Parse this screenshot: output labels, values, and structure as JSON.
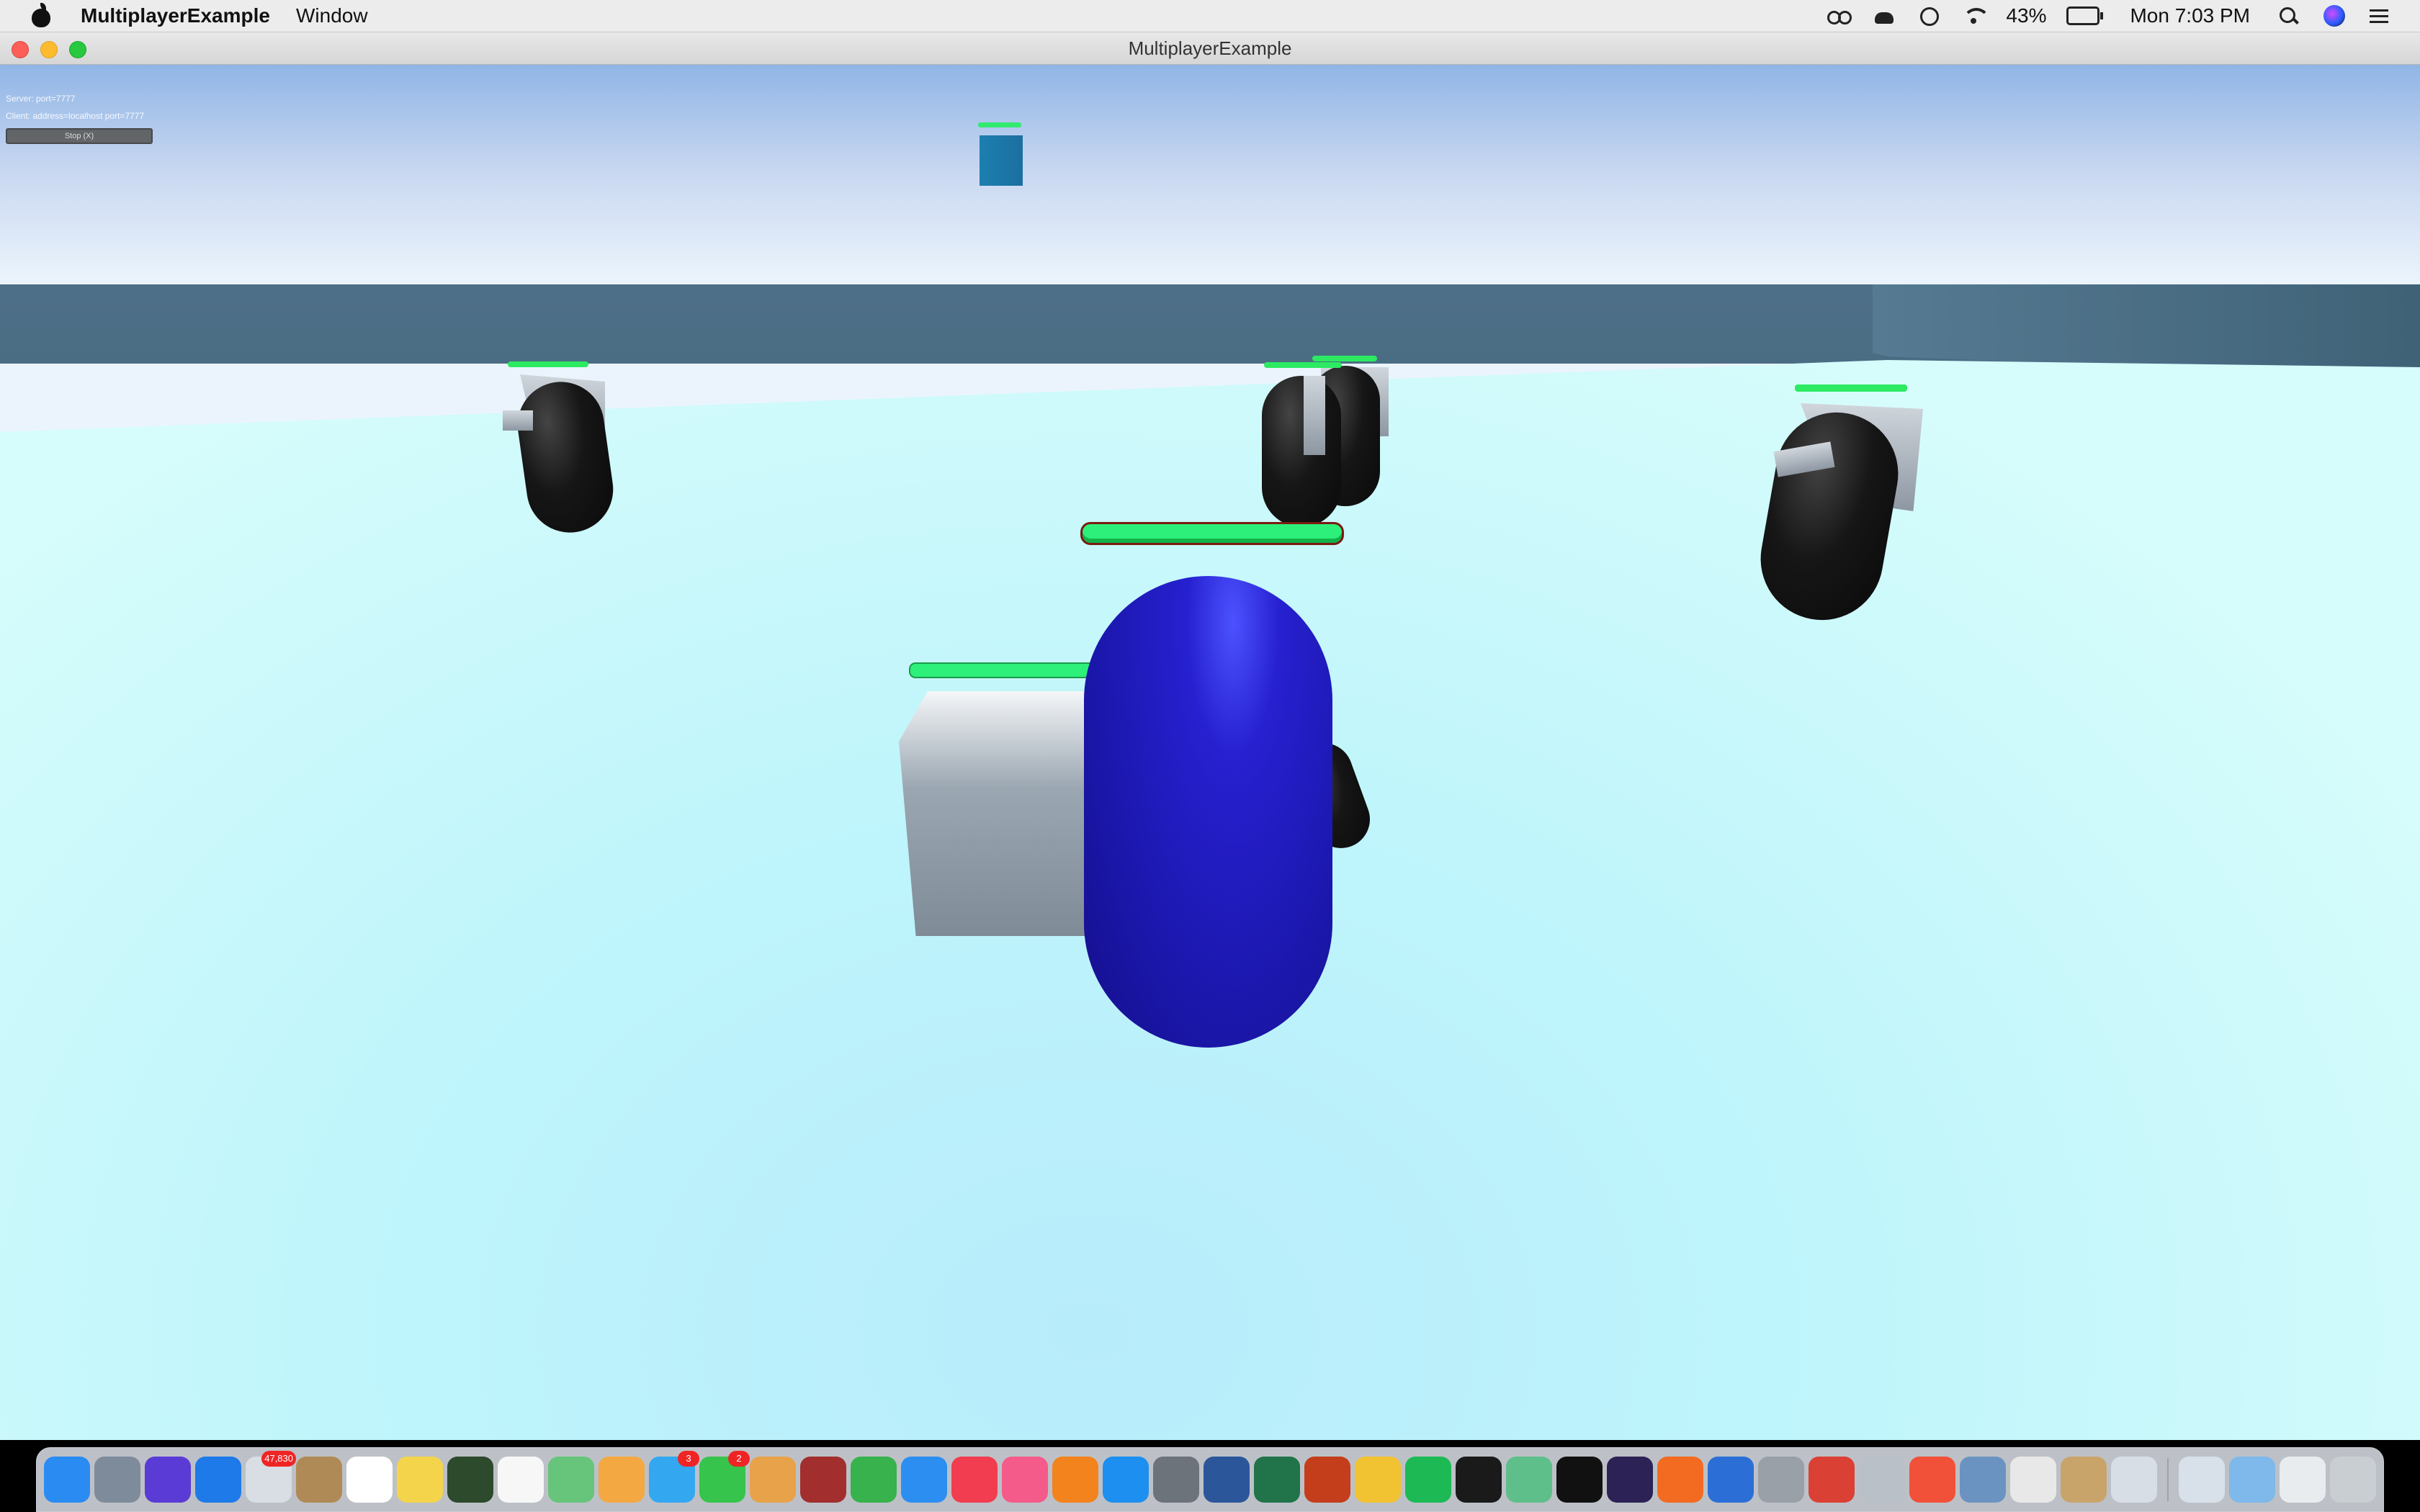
{
  "menubar": {
    "app_name": "MultiplayerExample",
    "items": [
      "Window"
    ],
    "battery_percent": "43%",
    "clock": "Mon 7:03 PM"
  },
  "window": {
    "title": "MultiplayerExample"
  },
  "hud": {
    "server": "Server: port=7777",
    "client": "Client: address=localhost port=7777",
    "stop_label": "Stop (X)"
  },
  "dock": {
    "apps": [
      {
        "name": "finder-icon",
        "color": "#2a8cf2"
      },
      {
        "name": "launchpad-icon",
        "color": "#7e8b9b"
      },
      {
        "name": "siri-icon",
        "color": "#5b3bd6"
      },
      {
        "name": "safari-icon",
        "color": "#1d7ae8"
      },
      {
        "name": "mail-icon",
        "color": "#d9dee4",
        "badge": "47,830"
      },
      {
        "name": "contacts-icon",
        "color": "#b08a56"
      },
      {
        "name": "calendar-icon",
        "color": "#ffffff"
      },
      {
        "name": "notes-icon",
        "color": "#f4d44b"
      },
      {
        "name": "mission-control-icon",
        "color": "#2d4a2c"
      },
      {
        "name": "reminders-icon",
        "color": "#f7f7f7"
      },
      {
        "name": "maps-icon",
        "color": "#66c57a"
      },
      {
        "name": "photos-icon",
        "color": "#f3a842"
      },
      {
        "name": "messages-icon",
        "color": "#34a7f1",
        "badge": "3"
      },
      {
        "name": "facetime-icon",
        "color": "#36c44c",
        "badge": "2"
      },
      {
        "name": "preview-icon",
        "color": "#e8a24a"
      },
      {
        "name": "dictionary-icon",
        "color": "#a22e2e"
      },
      {
        "name": "numbers-icon",
        "color": "#37b24d"
      },
      {
        "name": "keynote-icon",
        "color": "#2d8ef1"
      },
      {
        "name": "news-icon",
        "color": "#f23c4f"
      },
      {
        "name": "itunes-icon",
        "color": "#f45a8a"
      },
      {
        "name": "books-icon",
        "color": "#f2831d"
      },
      {
        "name": "app-store-icon",
        "color": "#1c8ff0"
      },
      {
        "name": "system-preferences-icon",
        "color": "#6d737a"
      },
      {
        "name": "word-icon",
        "color": "#2b579a"
      },
      {
        "name": "excel-icon",
        "color": "#21734a"
      },
      {
        "name": "powerpoint-icon",
        "color": "#c43e1c"
      },
      {
        "name": "chrome-icon",
        "color": "#f1c232"
      },
      {
        "name": "spotify-icon",
        "color": "#1db954"
      },
      {
        "name": "terminal-icon",
        "color": "#1a1a1a"
      },
      {
        "name": "atom-icon",
        "color": "#5fbf8a"
      },
      {
        "name": "intellij-icon",
        "color": "#111111"
      },
      {
        "name": "eclipse-icon",
        "color": "#2c2255"
      },
      {
        "name": "firefox-icon",
        "color": "#f26b21"
      },
      {
        "name": "firefox-dev-icon",
        "color": "#2b6fd6"
      },
      {
        "name": "tex-icon",
        "color": "#9aa0a8"
      },
      {
        "name": "todoist-icon",
        "color": "#db4035"
      },
      {
        "name": "pro-app-icon",
        "color": "#b9c0c8"
      },
      {
        "name": "swift-playgrounds-icon",
        "color": "#f05138"
      },
      {
        "name": "network-utility-icon",
        "color": "#6b93c1"
      },
      {
        "name": "unity-icon",
        "color": "#e8e8e8"
      },
      {
        "name": "archive-icon",
        "color": "#c9a46a"
      },
      {
        "name": "xcode-icon",
        "color": "#d8dee6"
      }
    ],
    "stack_apps": [
      {
        "name": "downloads-stack-icon",
        "color": "#d8e1ea"
      },
      {
        "name": "folder-stack-icon",
        "color": "#7fb8ea"
      },
      {
        "name": "documents-stack-icon",
        "color": "#e9ecef"
      },
      {
        "name": "trash-icon",
        "color": "#c9ced3"
      }
    ]
  }
}
